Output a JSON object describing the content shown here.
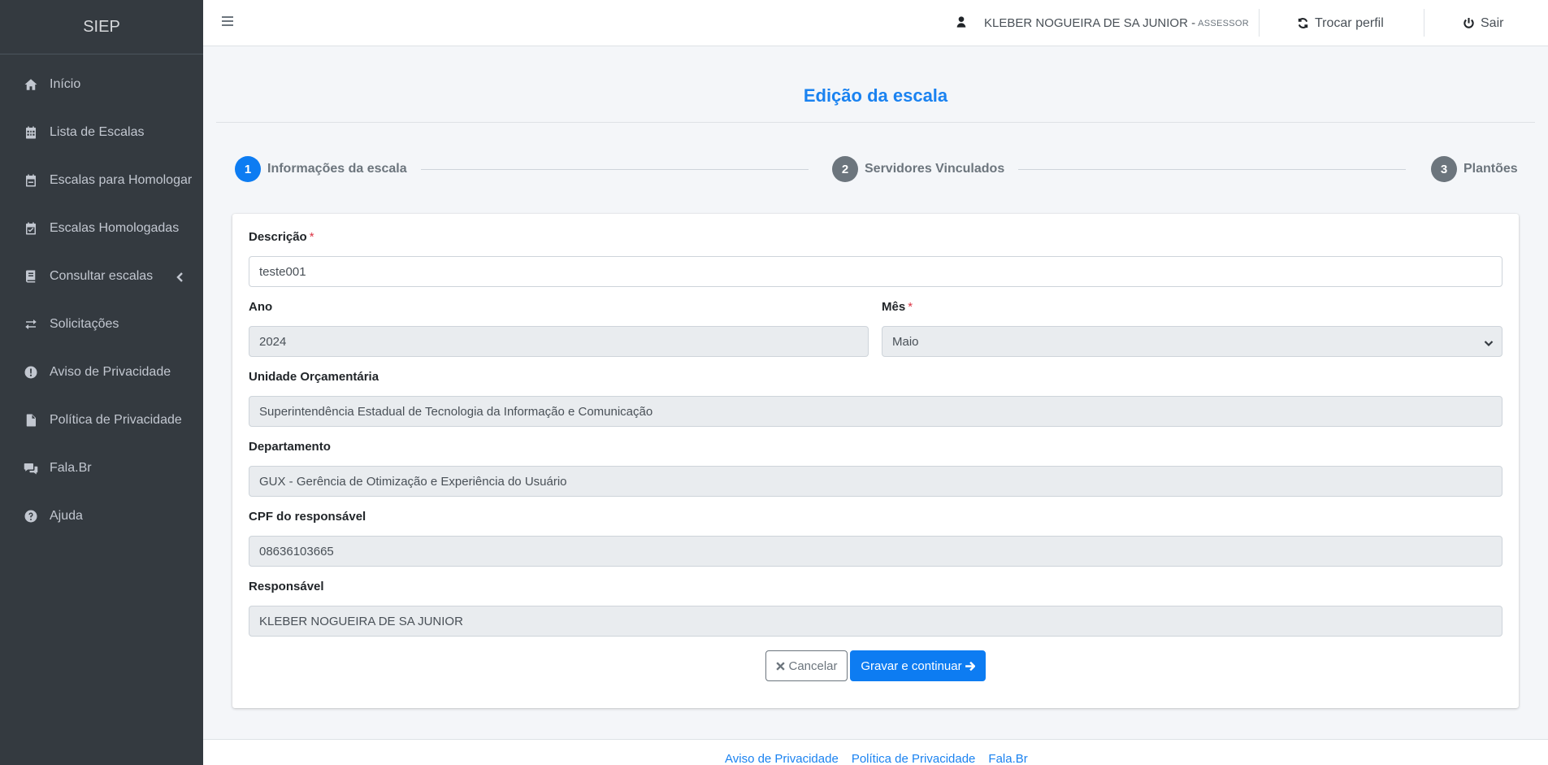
{
  "brand": "SIEP",
  "sidebar": {
    "items": [
      {
        "label": "Início",
        "icon": "home-icon"
      },
      {
        "label": "Lista de Escalas",
        "icon": "calendar-grid-icon"
      },
      {
        "label": "Escalas para Homologar",
        "icon": "calendar-minus-icon"
      },
      {
        "label": "Escalas Homologadas",
        "icon": "calendar-check-icon"
      },
      {
        "label": "Consultar escalas",
        "icon": "book-icon"
      },
      {
        "label": "Solicitações",
        "icon": "exchange-icon"
      },
      {
        "label": "Aviso de Privacidade",
        "icon": "exclamation-circle-icon"
      },
      {
        "label": "Política de Privacidade",
        "icon": "file-icon"
      },
      {
        "label": "Fala.Br",
        "icon": "comments-icon"
      },
      {
        "label": "Ajuda",
        "icon": "question-circle-icon"
      }
    ]
  },
  "header": {
    "user_name": "KLEBER NOGUEIRA DE SA JUNIOR -",
    "user_role": "ASSESSOR",
    "switch_profile": "Trocar perfil",
    "logout": "Sair"
  },
  "page": {
    "title": "Edição da escala",
    "steps": [
      {
        "number": "1",
        "label": "Informações da escala",
        "active": true
      },
      {
        "number": "2",
        "label": "Servidores Vinculados",
        "active": false
      },
      {
        "number": "3",
        "label": "Plantões",
        "active": false
      }
    ]
  },
  "form": {
    "descricao": {
      "label": "Descrição",
      "required": "*",
      "value": "teste001"
    },
    "ano": {
      "label": "Ano",
      "value": "2024"
    },
    "mes": {
      "label": "Mês",
      "required": "*",
      "value": "Maio"
    },
    "unidade": {
      "label": "Unidade Orçamentária",
      "value": "Superintendência Estadual de Tecnologia da Informação e Comunicação"
    },
    "departamento": {
      "label": "Departamento",
      "value": "GUX - Gerência de Otimização e Experiência do Usuário"
    },
    "cpf": {
      "label": "CPF do responsável",
      "value": "08636103665"
    },
    "responsavel": {
      "label": "Responsável",
      "value": "KLEBER NOGUEIRA DE SA JUNIOR"
    },
    "cancel_label": "Cancelar",
    "save_label": "Gravar e continuar"
  },
  "footer": {
    "links": [
      "Aviso de Privacidade",
      "Política de Privacidade",
      "Fala.Br"
    ]
  },
  "colors": {
    "sidebar_bg": "#343a40",
    "accent": "#0d7cf2",
    "step_inactive": "#6c757d",
    "required": "#dc3545"
  }
}
